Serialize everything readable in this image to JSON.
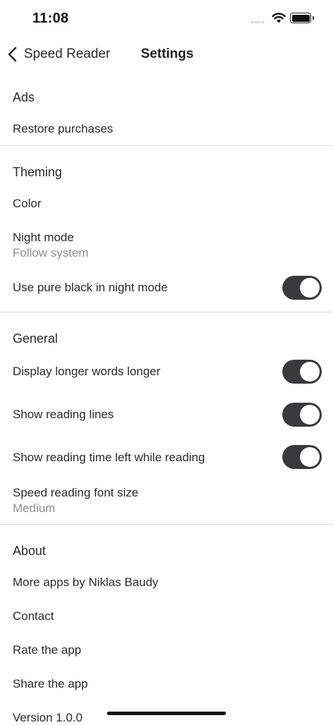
{
  "status_bar": {
    "time": "11:08"
  },
  "nav": {
    "back_label": "Speed Reader",
    "title": "Settings"
  },
  "sections": {
    "ads": {
      "header": "Ads",
      "restore": "Restore purchases"
    },
    "theming": {
      "header": "Theming",
      "color": "Color",
      "night_mode": "Night mode",
      "night_mode_value": "Follow system",
      "pure_black": "Use pure black in night mode",
      "pure_black_on": true
    },
    "general": {
      "header": "General",
      "longer_words": "Display longer words longer",
      "longer_words_on": true,
      "reading_lines": "Show reading lines",
      "reading_lines_on": true,
      "time_left": "Show reading time left while reading",
      "time_left_on": true,
      "font_size": "Speed reading font size",
      "font_size_value": "Medium"
    },
    "about": {
      "header": "About",
      "more_apps": "More apps by Niklas Baudy",
      "contact": "Contact",
      "rate": "Rate the app",
      "share": "Share the app",
      "version": "Version 1.0.0"
    }
  },
  "colors": {
    "toggle_on": "#3a3a3c",
    "divider": "#d9d9d9",
    "secondary_text": "#8f8f8f"
  }
}
